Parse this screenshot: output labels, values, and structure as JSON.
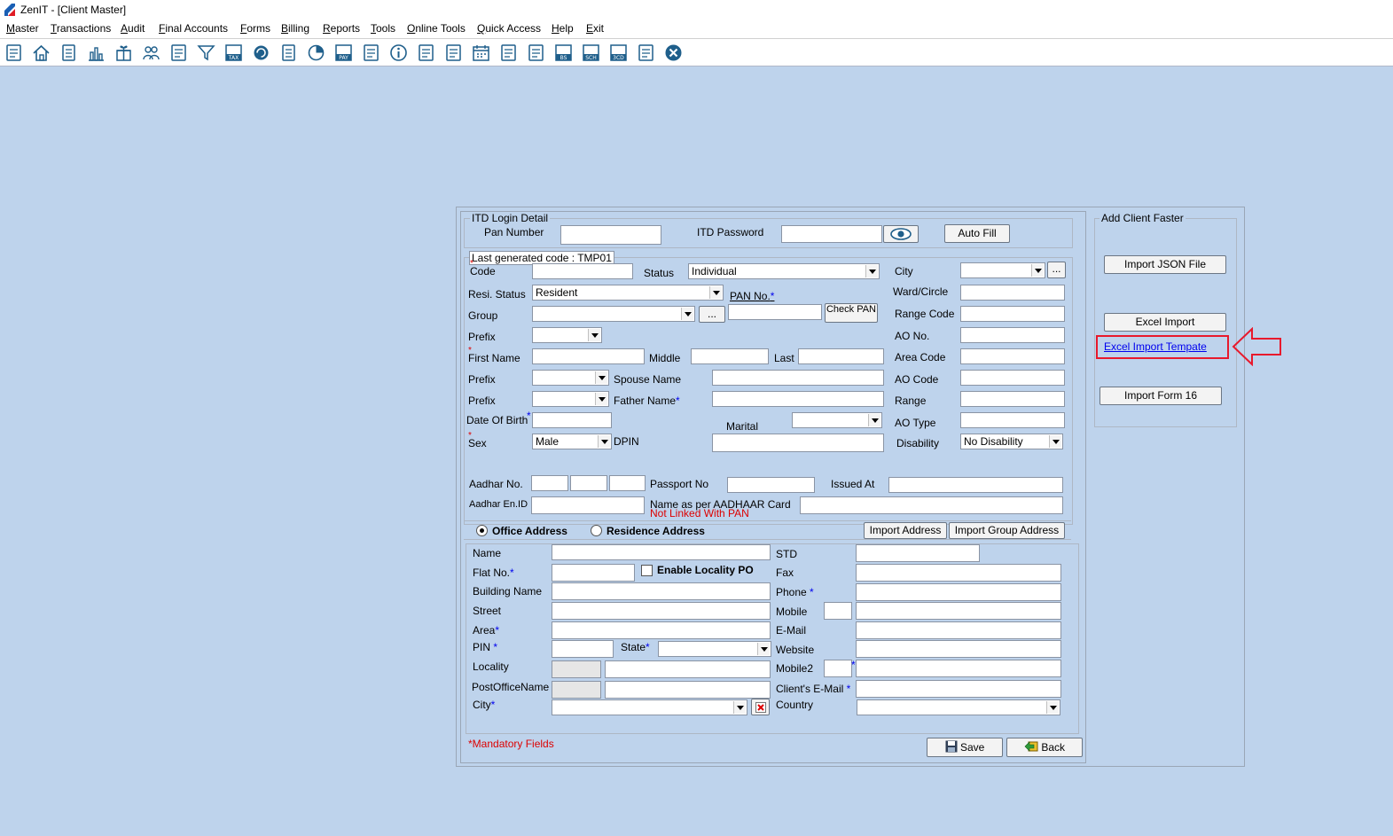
{
  "window": {
    "title": "ZenIT - [Client Master]"
  },
  "menu": [
    "Master",
    "Transactions",
    "Audit",
    "Final Accounts",
    "Forms",
    "Billing",
    "Reports",
    "Tools",
    "Online Tools",
    "Quick Access",
    "Help",
    "Exit"
  ],
  "toolbar_icons": [
    "receipt-icon",
    "home-icon",
    "building-icon",
    "bar-chart-icon",
    "gift-icon",
    "users-icon",
    "pin-icon",
    "filter-icon",
    "tax-icon",
    "refresh-icon",
    "calculator-icon",
    "pie-icon",
    "pay-icon",
    "book-icon",
    "info-icon",
    "report-icon",
    "document-user-icon",
    "calendar-icon",
    "folder-add-icon",
    "copy-icon",
    "bs-icon",
    "bs-sch-icon",
    "3cd-icon",
    "form-icon",
    "close-icon"
  ],
  "itd": {
    "legend": "ITD Login Detail",
    "pan_label": "Pan Number",
    "pan_value": "",
    "password_label": "ITD Password",
    "password_value": "",
    "autofill": "Auto Fill"
  },
  "client": {
    "last_code": "Last generated code : TMP01",
    "code_label": "Code",
    "code_value": "",
    "status_label": "Status",
    "status_value": "Individual",
    "resi_label": "Resi. Status",
    "resi_value": "Resident",
    "pan_label": "PAN No.",
    "pan_value": "",
    "check_pan": "Check PAN",
    "group_label": "Group",
    "group_value": "",
    "prefix_label": "Prefix",
    "first_name_label": "First Name",
    "middle_label": "Middle",
    "last_label": "Last",
    "spouse_label": "Spouse Name",
    "father_label": "Father Name",
    "dob_label": "Date Of Birth",
    "marital_label": "Marital",
    "sex_label": "Sex",
    "sex_value": "Male",
    "dpin_label": "DPIN",
    "city_label": "City",
    "ward_label": "Ward/Circle",
    "range_code_label": "Range Code",
    "ao_no_label": "AO No.",
    "area_code_label": "Area Code",
    "ao_code_label": "AO Code",
    "range_label": "Range",
    "ao_type_label": "AO Type",
    "disability_label": "Disability",
    "disability_value": "No Disability",
    "aadhar_label": "Aadhar No.",
    "passport_label": "Passport No",
    "issued_label": "Issued At",
    "aadhar_en_label": "Aadhar En.ID",
    "name_aadhaar_label": "Name as per AADHAAR Card",
    "not_linked": "Not Linked With PAN",
    "ellipsis": "..."
  },
  "address": {
    "office": "Office Address",
    "residence": "Residence Address",
    "import_address": "Import Address",
    "import_group_address": "Import Group Address",
    "name_label": "Name",
    "flat_label": "Flat No.",
    "enable_locality": "Enable Locality PO",
    "building_label": "Building Name",
    "street_label": "Street",
    "area_label": "Area",
    "pin_label": "PIN",
    "state_label": "State",
    "locality_label": "Locality",
    "postoffice_label": "PostOfficeName",
    "city_label": "City",
    "std_label": "STD",
    "fax_label": "Fax",
    "phone_label": "Phone",
    "mobile_label": "Mobile",
    "email_label": "E-Mail",
    "website_label": "Website",
    "mobile2_label": "Mobile2",
    "client_email_label": "Client's E-Mail",
    "country_label": "Country"
  },
  "footer": {
    "mandatory": "*Mandatory Fields",
    "save": "Save",
    "back": "Back"
  },
  "faster": {
    "legend": "Add Client Faster",
    "import_json": "Import JSON File",
    "excel_import": "Excel Import",
    "excel_template": "Excel Import Tempate",
    "import_form16": "Import Form 16"
  },
  "colors": {
    "background": "#bed3ec",
    "highlight": "#e8192c",
    "link": "#0000ee"
  }
}
